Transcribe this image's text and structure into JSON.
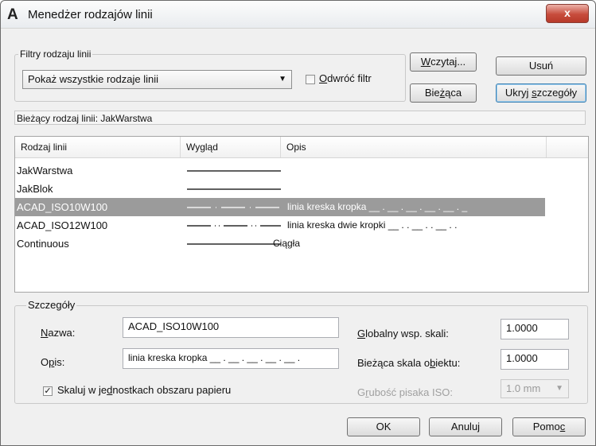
{
  "window": {
    "title": "Menedżer rodzajów linii",
    "close_label": "x"
  },
  "filters": {
    "group_label": "Filtry rodzaju linii",
    "selected": "Pokaż wszystkie rodzaje linii",
    "invert_label": "Odwróć filtr",
    "invert_checked": false
  },
  "buttons": {
    "load": "Wczytaj...",
    "delete": "Usuń",
    "current": "Bieżąca",
    "hide_details": "Ukryj szczegóły",
    "ok": "OK",
    "cancel": "Anuluj",
    "help": "Pomoc"
  },
  "current_linetype": "Bieżący rodzaj linii:  JakWarstwa",
  "table": {
    "columns": [
      "Rodzaj linii",
      "Wygląd",
      "Opis"
    ],
    "rows": [
      {
        "name": "JakWarstwa",
        "desc": "",
        "pattern": "solid",
        "selected": false
      },
      {
        "name": "JakBlok",
        "desc": "",
        "pattern": "solid",
        "selected": false
      },
      {
        "name": "ACAD_ISO10W100",
        "desc": "linia kreska kropka __ . __ . __ . __ . __ . _",
        "pattern": "dashdot",
        "selected": true
      },
      {
        "name": "ACAD_ISO12W100",
        "desc": "linia kreska dwie kropki __ . . __ . . __ . .",
        "pattern": "dashdotdot",
        "selected": false
      },
      {
        "name": "Continuous",
        "desc": "Ciągła",
        "pattern": "solid",
        "selected": false
      }
    ]
  },
  "details": {
    "group_label": "Szczegóły",
    "name_label": "Nazwa:",
    "name_value": "ACAD_ISO10W100",
    "desc_label": "Opis:",
    "desc_value": "linia kreska kropka __ . __ . __ . __ . __ .",
    "scale_paper_label": "Skaluj w jednostkach obszaru papieru",
    "scale_paper_checked": true,
    "global_scale_label": "Globalny wsp. skali:",
    "global_scale_value": "1.0000",
    "object_scale_label": "Bieżąca skala obiektu:",
    "object_scale_value": "1.0000",
    "pen_width_label": "Grubość pisaka ISO:",
    "pen_width_value": "1.0 mm"
  }
}
